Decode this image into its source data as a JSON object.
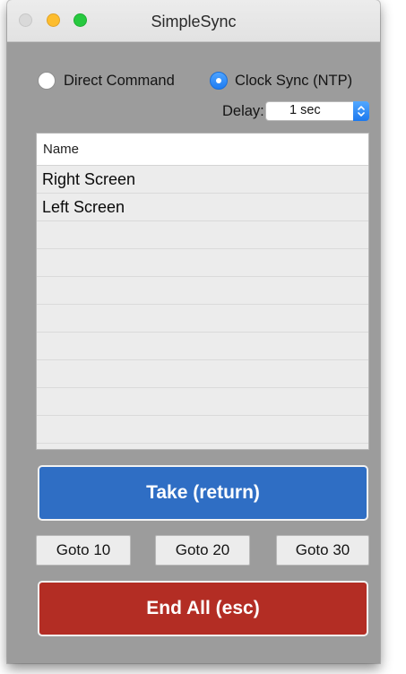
{
  "window": {
    "title": "SimpleSync"
  },
  "mode": {
    "options": [
      {
        "label": "Direct Command",
        "selected": false
      },
      {
        "label": "Clock Sync (NTP)",
        "selected": true
      }
    ]
  },
  "delay": {
    "label": "Delay:",
    "value": "1 sec"
  },
  "table": {
    "header": "Name",
    "rows": [
      "Right Screen",
      "Left Screen",
      "",
      "",
      "",
      "",
      "",
      "",
      "",
      ""
    ]
  },
  "actions": {
    "take_label": "Take (return)",
    "goto": [
      "Goto 10",
      "Goto 20",
      "Goto 30"
    ],
    "end_label": "End All (esc)"
  },
  "colors": {
    "take_button": "#2f6ec4",
    "end_button": "#b32d24",
    "accent": "#1e7cf2",
    "window_bg": "#9c9c9c"
  }
}
